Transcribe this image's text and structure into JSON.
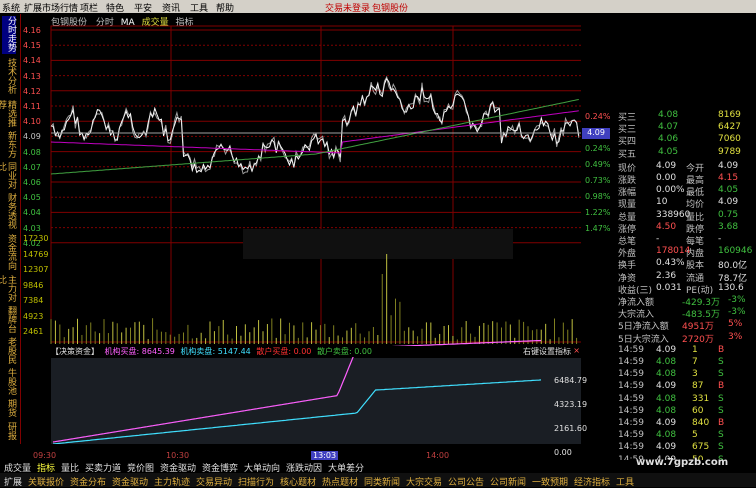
{
  "menubar": {
    "items": [
      "系统",
      "扩展市场行情",
      "功能",
      "资讯",
      "工具",
      "帮助"
    ],
    "left_items": [
      "系统",
      "扩展市场行情",
      "项栏",
      "特色",
      "平安",
      "资讯",
      "工具",
      "帮助"
    ],
    "right_items": [
      "交易未登录",
      "包钢股份"
    ]
  },
  "left_tabs": [
    "分时走势",
    "技术分析",
    "精选推荐",
    "新东方",
    "同业对比",
    "财务透视",
    "资金流向",
    "主力对比",
    "翻牌台",
    "老股民",
    "牛股池",
    "期货",
    "研报"
  ],
  "chart": {
    "stock_name": "包钢股份",
    "mode": "分时",
    "ma_label": "MA",
    "vol_label": "成交量",
    "indicator_label": "指标",
    "price_labels_left": [
      "4.16",
      "4.15",
      "4.14",
      "4.13",
      "4.12",
      "4.11",
      "4.10",
      "4.09",
      "4.08",
      "4.07",
      "4.06",
      "4.05",
      "4.04",
      "4.03",
      "4.02"
    ],
    "pct_labels_right": [
      "0.24%",
      "0.00%",
      "0.24%",
      "0.49%",
      "0.73%",
      "0.98%",
      "1.22%",
      "1.47%"
    ],
    "price_marker": "4.09",
    "vol_labels": [
      "17230",
      "14769",
      "12307",
      "9846",
      "7384",
      "4923",
      "2461"
    ],
    "bottom_panel": {
      "title": "【决策资金】",
      "items": [
        {
          "label": "机构买盘",
          "value": "8645.39"
        },
        {
          "label": "机构卖盘",
          "value": "5147.44"
        },
        {
          "label": "散户买盘",
          "value": "0.00"
        },
        {
          "label": "散户卖盘",
          "value": "0.00"
        }
      ],
      "right_hint": "右键设置指标",
      "close_label": "×",
      "y_labels": [
        "6484.79",
        "4323.19",
        "2161.60",
        "0.00"
      ],
      "time_labels": [
        "09:30",
        "10:30",
        "13:03",
        "14:00"
      ]
    }
  },
  "quote": {
    "asks": [
      {
        "label": "买三",
        "price": "4.08",
        "vol": "8169"
      },
      {
        "label": "买三",
        "price": "4.07",
        "vol": "6427"
      },
      {
        "label": "买四",
        "price": "4.06",
        "vol": "7060"
      },
      {
        "label": "买五",
        "price": "4.05",
        "vol": "9789"
      }
    ],
    "stats": [
      {
        "l1": "现价",
        "v1": "4.09",
        "l2": "今开",
        "v2": "4.09"
      },
      {
        "l1": "涨跌",
        "v1": "0.00",
        "l2": "最高",
        "v2": "4.15"
      },
      {
        "l1": "涨幅",
        "v1": "0.00%",
        "l2": "最低",
        "v2": "4.05"
      },
      {
        "l1": "现量",
        "v1": "10",
        "l2": "均价",
        "v2": "4.09"
      },
      {
        "l1": "总量",
        "v1": "338960",
        "l2": "量比",
        "v2": "0.75"
      },
      {
        "l1": "涨停",
        "v1": "4.50",
        "l2": "跌停",
        "v2": "3.68"
      },
      {
        "l1": "总笔",
        "v1": "-",
        "l2": "每笔",
        "v2": "-"
      },
      {
        "l1": "外盘",
        "v1": "178014",
        "l2": "内盘",
        "v2": "160946"
      },
      {
        "l1": "换手",
        "v1": "0.43%",
        "l2": "股本",
        "v2": "80.0亿"
      },
      {
        "l1": "净资",
        "v1": "2.36",
        "l2": "流通",
        "v2": "78.7亿"
      },
      {
        "l1": "收益(三)",
        "v1": "0.031",
        "l2": "PE(动)",
        "v2": "130.6"
      }
    ],
    "flows": [
      {
        "label": "净流入额",
        "value": "-429.3万",
        "pct": "-3%"
      },
      {
        "label": "大宗流入",
        "value": "-483.5万",
        "pct": "-3%"
      },
      {
        "label": "5日净流入额",
        "value": "4951万",
        "pct": "5%"
      },
      {
        "label": "5日大宗流入",
        "value": "2720万",
        "pct": "3%"
      }
    ],
    "ticks": [
      {
        "time": "14:59",
        "price": "4.09",
        "vol": "1",
        "side": "B"
      },
      {
        "time": "14:59",
        "price": "4.08",
        "vol": "7",
        "side": "S"
      },
      {
        "time": "14:59",
        "price": "4.08",
        "vol": "3",
        "side": "S"
      },
      {
        "time": "14:59",
        "price": "4.09",
        "vol": "87",
        "side": "B"
      },
      {
        "time": "14:59",
        "price": "4.08",
        "vol": "331",
        "side": "S"
      },
      {
        "time": "14:59",
        "price": "4.08",
        "vol": "60",
        "side": "S"
      },
      {
        "time": "14:59",
        "price": "4.09",
        "vol": "840",
        "side": "B"
      },
      {
        "time": "14:59",
        "price": "4.08",
        "vol": "5",
        "side": "S"
      },
      {
        "time": "14:59",
        "price": "4.09",
        "vol": "675",
        "side": "S"
      },
      {
        "time": "14:59",
        "price": "4.09",
        "vol": "50",
        "side": "S"
      }
    ]
  },
  "bottom_bar1": [
    "成交量",
    "指标",
    "量比",
    "买卖力道",
    "竞价图",
    "资金驱动",
    "资金博弈",
    "大单动向",
    "涨跌动因",
    "大单差分"
  ],
  "bottom_bar2": [
    "扩展",
    "关联报价",
    "资金分布",
    "资金驱动",
    "主力轨迹",
    "交易异动",
    "扫描行为",
    "核心题材",
    "热点题材",
    "同类新闻",
    "大宗交易",
    "公司公告",
    "公司新闻",
    "一致预期",
    "经济指标",
    "工具"
  ],
  "watermark": "www.7gpzb.com",
  "colors": {
    "up": "#ff5050",
    "down": "#40c040",
    "grid": "#800000",
    "price": "#ffffff",
    "avg": "#c000c0",
    "ma": "#40a040",
    "inst_buy": "#ff60ff",
    "inst_sell": "#40e0ff"
  }
}
